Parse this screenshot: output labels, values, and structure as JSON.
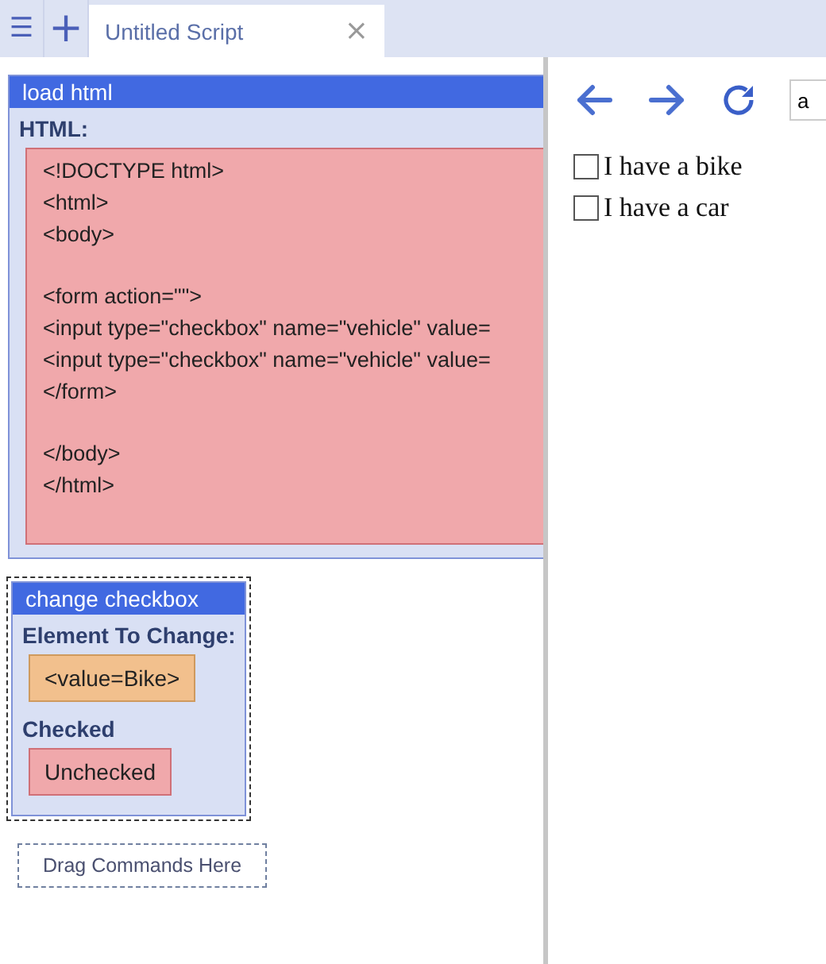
{
  "menu_button": {
    "icon": "☰"
  },
  "new_tab_button": {
    "icon": "+"
  },
  "tabs": [
    {
      "label": "Untitled Script",
      "selected": true,
      "close": "×"
    }
  ],
  "commands": [
    {
      "kind": "load_html",
      "title": "load html",
      "selected": false,
      "fields": [
        {
          "label": "HTML:",
          "kind": "code",
          "blocks": [
            [
              "<!DOCTYPE html>",
              "<html>",
              "<body>"
            ],
            [
              "<form action=\"\">",
              "<input type=\"checkbox\" name=\"vehicle\" value=",
              "<input type=\"checkbox\" name=\"vehicle\" value=",
              "</form>"
            ],
            [
              "</body>",
              "</html>"
            ]
          ]
        }
      ]
    },
    {
      "kind": "change_checkbox",
      "title": "change checkbox",
      "selected": true,
      "fields": [
        {
          "label": "Element To Change:",
          "kind": "element",
          "value": "<value=Bike>"
        },
        {
          "label": "Checked",
          "kind": "state",
          "value": "Unchecked"
        }
      ]
    }
  ],
  "drop_zone": "Drag Commands Here",
  "browser": {
    "address": "a",
    "page": [
      {
        "label": "I have a bike",
        "checked": false
      },
      {
        "label": "I have a car",
        "checked": false
      }
    ]
  }
}
